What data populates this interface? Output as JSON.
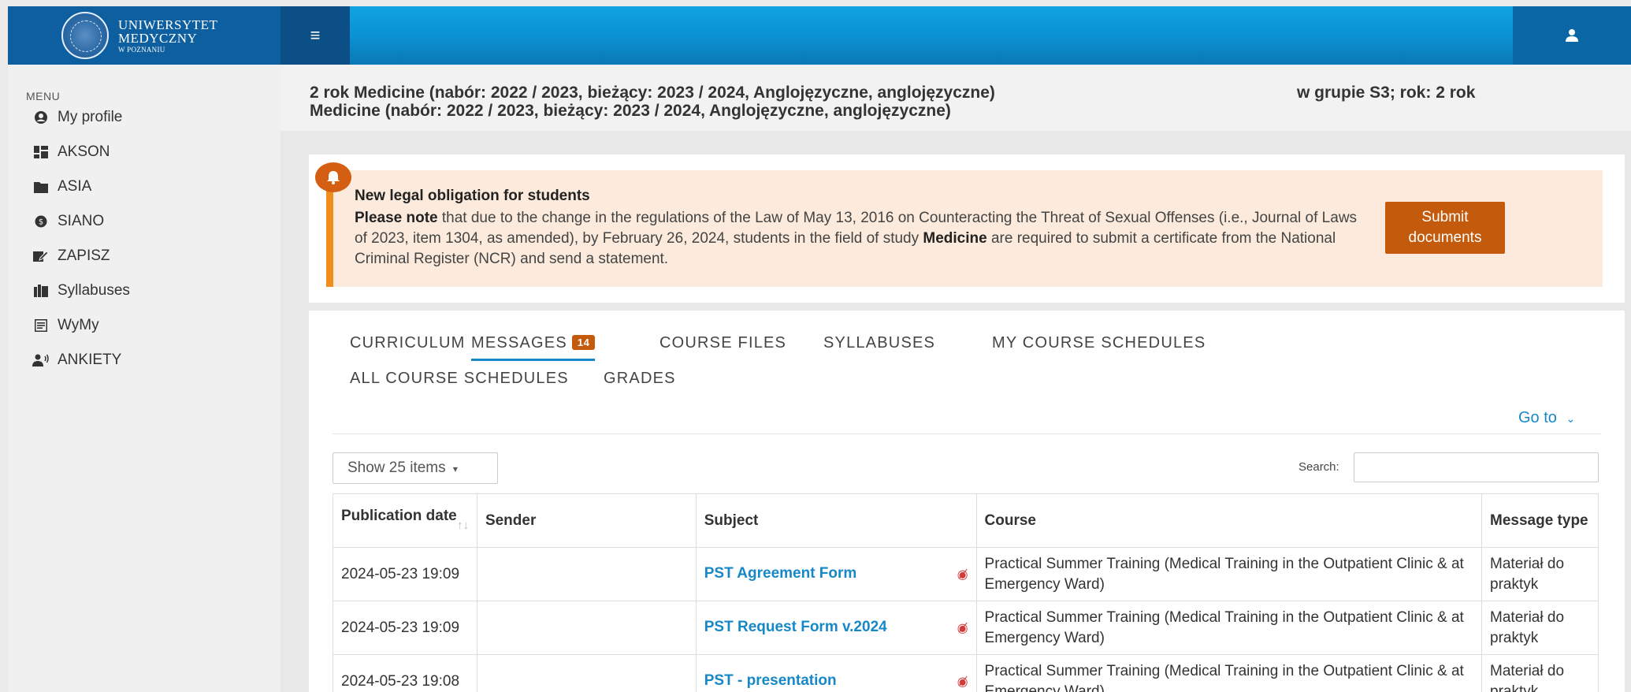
{
  "brand": {
    "line1": "UNIWERSYTET",
    "line2": "MEDYCZNY",
    "line3": "W POZNANIU"
  },
  "sidebar": {
    "title": "MENU",
    "items": [
      {
        "label": "My profile",
        "icon": "user-circle-icon"
      },
      {
        "label": "AKSON",
        "icon": "dashboard-icon"
      },
      {
        "label": "ASIA",
        "icon": "folder-icon"
      },
      {
        "label": "SIANO",
        "icon": "coin-icon"
      },
      {
        "label": "ZAPISZ",
        "icon": "edit-icon"
      },
      {
        "label": "Syllabuses",
        "icon": "books-icon"
      },
      {
        "label": "WyMy",
        "icon": "list-icon"
      },
      {
        "label": "ANKIETY",
        "icon": "survey-icon"
      }
    ]
  },
  "program": {
    "line1": "2 rok Medicine (nabór: 2022 / 2023, bieżący: 2023 / 2024, Anglojęzyczne, anglojęzyczne)",
    "line2": "Medicine (nabór: 2022 / 2023, bieżący: 2023 / 2024, Anglojęzyczne, anglojęzyczne)",
    "group": "w grupie S3; rok: 2 rok"
  },
  "alert": {
    "title": "New legal obligation for students",
    "bold1": "Please note",
    "text1": " that due to the change in the regulations of the Law of May 13, 2016 on Counteracting the Threat of Sexual Offenses (i.e., Journal of Laws of 2023, item 1304, as amended), by February 26, 2024, students in the field of study ",
    "bold2": "Medicine",
    "text2": " are required to submit a certificate from the National Criminal Register (NCR) and send a statement.",
    "button": "Submit documents"
  },
  "tabs": {
    "curriculum": "CURRICULUM",
    "messages": "MESSAGES",
    "messages_count": "14",
    "course_files": "COURSE FILES",
    "syllabuses": "SYLLABUSES",
    "my_schedules": "MY COURSE SCHEDULES",
    "all_schedules": "ALL COURSE SCHEDULES",
    "grades": "GRADES"
  },
  "toolbar": {
    "goto": "Go to",
    "show_items": "Show 25 items",
    "search_label": "Search:",
    "search_value": ""
  },
  "table": {
    "headers": {
      "date": "Publication date",
      "sender": "Sender",
      "subject": "Subject",
      "course": "Course",
      "type": "Message type"
    },
    "rows": [
      {
        "date": "2024-05-23 19:09",
        "sender": "",
        "subject": "PST Agreement Form",
        "course": "Practical Summer Training (Medical Training in the Outpatient Clinic & at Emergency Ward)",
        "type": "Materiał do praktyk"
      },
      {
        "date": "2024-05-23 19:09",
        "sender": "",
        "subject": "PST Request Form v.2024",
        "course": "Practical Summer Training (Medical Training in the Outpatient Clinic & at Emergency Ward)",
        "type": "Materiał do praktyk"
      },
      {
        "date": "2024-05-23 19:08",
        "sender": "",
        "subject": "PST - presentation",
        "course": "Practical Summer Training (Medical Training in the Outpatient Clinic & at Emergency Ward)",
        "type": "Materiał do praktyk"
      }
    ]
  },
  "colors": {
    "accent": "#1688c8",
    "warning": "#c45a0c",
    "topbar": "#0d5f9f"
  }
}
